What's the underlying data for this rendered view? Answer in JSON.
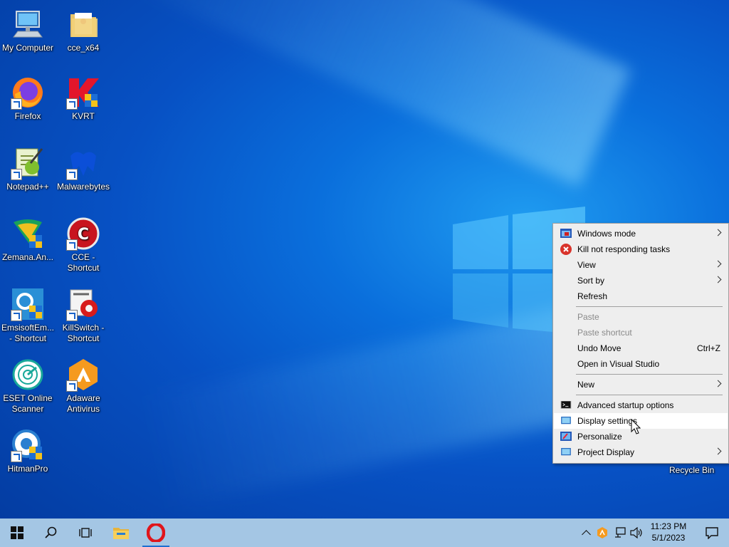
{
  "desktop": {
    "icons": [
      {
        "label": "My Computer"
      },
      {
        "label": "cce_x64"
      },
      {
        "label": "Firefox"
      },
      {
        "label": "KVRT"
      },
      {
        "label": "Notepad++"
      },
      {
        "label": "Malwarebytes"
      },
      {
        "label": "Zemana.An..."
      },
      {
        "label": "CCE - Shortcut"
      },
      {
        "label": "EmsisoftEm... - Shortcut"
      },
      {
        "label": "KillSwitch - Shortcut"
      },
      {
        "label": "ESET Online Scanner"
      },
      {
        "label": "Adaware Antivirus"
      },
      {
        "label": "HitmanPro"
      }
    ],
    "recycle_bin": "Recycle Bin"
  },
  "context_menu": {
    "items": [
      {
        "label": "Windows mode",
        "icon": "window-mode-icon"
      },
      {
        "label": "Kill not responding tasks",
        "icon": "red-x-icon"
      },
      {
        "label": "View"
      },
      {
        "label": "Sort by"
      },
      {
        "label": "Refresh"
      },
      {
        "label": "Paste"
      },
      {
        "label": "Paste shortcut"
      },
      {
        "label": "Undo Move",
        "accelerator": "Ctrl+Z"
      },
      {
        "label": "Open in Visual Studio"
      },
      {
        "label": "New"
      },
      {
        "label": "Advanced startup options",
        "icon": "cmd-icon"
      },
      {
        "label": "Display settings",
        "icon": "display-icon"
      },
      {
        "label": "Personalize",
        "icon": "personalize-icon"
      },
      {
        "label": "Project Display",
        "icon": "project-display-icon"
      }
    ]
  },
  "taskbar": {
    "time": "11:23 PM",
    "date": "5/1/2023"
  },
  "colors": {
    "taskbar_bg": "#a4c6e4",
    "menu_bg": "#eeeeee",
    "opera_red": "#e0151b"
  }
}
